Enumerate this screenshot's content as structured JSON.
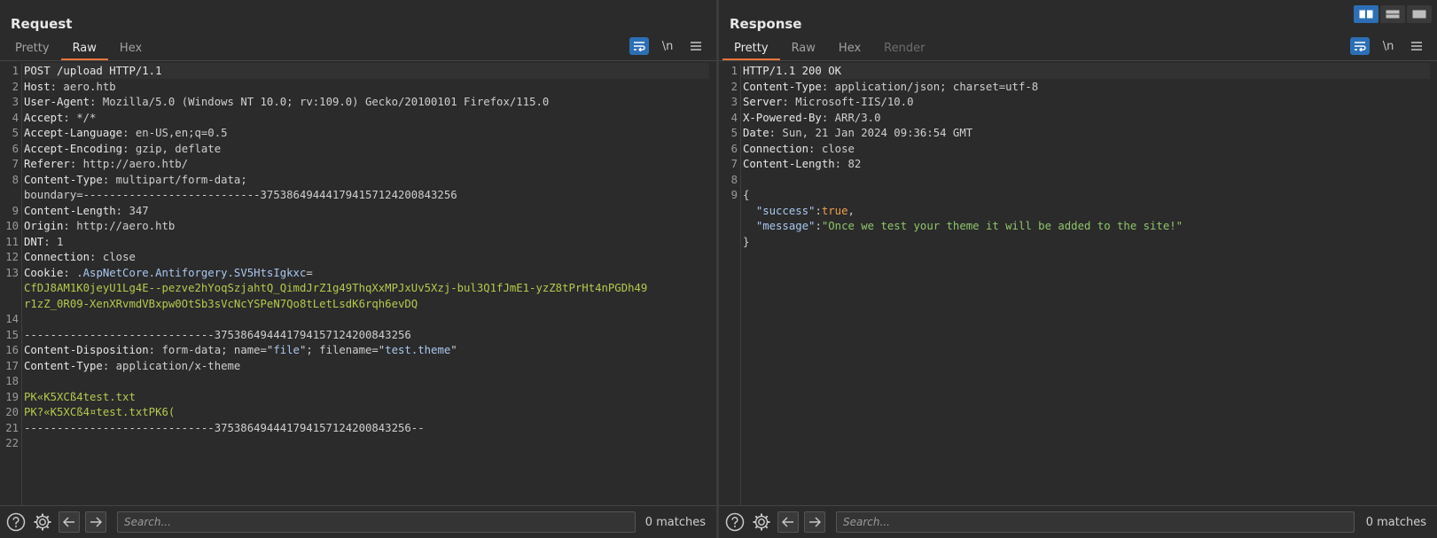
{
  "request": {
    "title": "Request",
    "tabs": [
      {
        "label": "Pretty",
        "state": "normal"
      },
      {
        "label": "Raw",
        "state": "active"
      },
      {
        "label": "Hex",
        "state": "normal"
      }
    ],
    "newline_toggle": "\\n",
    "lines": [
      {
        "n": "1",
        "parts": [
          {
            "t": "POST /upload HTTP/1.1",
            "c": "k"
          }
        ]
      },
      {
        "n": "2",
        "parts": [
          {
            "t": "Host",
            "c": "k"
          },
          {
            "t": ": aero.htb",
            "c": "v"
          }
        ]
      },
      {
        "n": "3",
        "parts": [
          {
            "t": "User-Agent",
            "c": "k"
          },
          {
            "t": ": Mozilla/5.0 (Windows NT 10.0; rv:109.0) Gecko/20100101 Firefox/115.0",
            "c": "v"
          }
        ]
      },
      {
        "n": "4",
        "parts": [
          {
            "t": "Accept",
            "c": "k"
          },
          {
            "t": ": */*",
            "c": "v"
          }
        ]
      },
      {
        "n": "5",
        "parts": [
          {
            "t": "Accept-Language",
            "c": "k"
          },
          {
            "t": ": en-US,en;q=0.5",
            "c": "v"
          }
        ]
      },
      {
        "n": "6",
        "parts": [
          {
            "t": "Accept-Encoding",
            "c": "k"
          },
          {
            "t": ": gzip, deflate",
            "c": "v"
          }
        ]
      },
      {
        "n": "7",
        "parts": [
          {
            "t": "Referer",
            "c": "k"
          },
          {
            "t": ": http://aero.htb/",
            "c": "v"
          }
        ]
      },
      {
        "n": "8",
        "parts": [
          {
            "t": "Content-Type",
            "c": "k"
          },
          {
            "t": ": multipart/form-data;",
            "c": "v"
          }
        ]
      },
      {
        "n": "",
        "parts": [
          {
            "t": "boundary=---------------------------375386494441794157124200843256",
            "c": "v"
          }
        ]
      },
      {
        "n": "9",
        "parts": [
          {
            "t": "Content-Length",
            "c": "k"
          },
          {
            "t": ": 347",
            "c": "v"
          }
        ]
      },
      {
        "n": "10",
        "parts": [
          {
            "t": "Origin",
            "c": "k"
          },
          {
            "t": ": http://aero.htb",
            "c": "v"
          }
        ]
      },
      {
        "n": "11",
        "parts": [
          {
            "t": "DNT",
            "c": "k"
          },
          {
            "t": ": 1",
            "c": "v"
          }
        ]
      },
      {
        "n": "12",
        "parts": [
          {
            "t": "Connection",
            "c": "k"
          },
          {
            "t": ": close",
            "c": "v"
          }
        ]
      },
      {
        "n": "13",
        "parts": [
          {
            "t": "Cookie",
            "c": "k"
          },
          {
            "t": ": ",
            "c": "v"
          },
          {
            "t": ".AspNetCore.Antiforgery.SV5HtsIgkxc",
            "c": "blue-t"
          },
          {
            "t": "=",
            "c": "v"
          }
        ]
      },
      {
        "n": "",
        "parts": [
          {
            "t": "CfDJ8AM1K0jeyU1Lg4E--pezve2hYoqSzjahtQ_QimdJrZ1g49ThqXxMPJxUv5Xzj-bul3Q1fJmE1-yzZ8tPrHt4nPGDh49",
            "c": "g"
          }
        ]
      },
      {
        "n": "",
        "parts": [
          {
            "t": "r1zZ_0R09-XenXRvmdVBxpw0OtSb3sVcNcYSPeN7Qo8tLetLsdK6rqh6evDQ",
            "c": "g"
          }
        ]
      },
      {
        "n": "14",
        "parts": []
      },
      {
        "n": "15",
        "parts": [
          {
            "t": "-----------------------------375386494441794157124200843256",
            "c": "v"
          }
        ]
      },
      {
        "n": "16",
        "parts": [
          {
            "t": "Content-Disposition",
            "c": "k"
          },
          {
            "t": ": form-data; name=\"",
            "c": "v"
          },
          {
            "t": "file",
            "c": "blue-t"
          },
          {
            "t": "\"; filename=\"",
            "c": "v"
          },
          {
            "t": "test.theme",
            "c": "blue-t"
          },
          {
            "t": "\"",
            "c": "v"
          }
        ]
      },
      {
        "n": "17",
        "parts": [
          {
            "t": "Content-Type",
            "c": "k"
          },
          {
            "t": ": application/x-theme",
            "c": "v"
          }
        ]
      },
      {
        "n": "18",
        "parts": []
      },
      {
        "n": "19",
        "parts": [
          {
            "t": "PK«K5XCß4test.txt",
            "c": "g"
          }
        ]
      },
      {
        "n": "20",
        "parts": [
          {
            "t": "PK?«K5XCß4¤test.txtPK6(",
            "c": "g"
          }
        ]
      },
      {
        "n": "21",
        "parts": [
          {
            "t": "-----------------------------375386494441794157124200843256--",
            "c": "v"
          }
        ]
      },
      {
        "n": "22",
        "parts": []
      }
    ],
    "search_placeholder": "Search...",
    "matches": "0 matches"
  },
  "response": {
    "title": "Response",
    "tabs": [
      {
        "label": "Pretty",
        "state": "active"
      },
      {
        "label": "Raw",
        "state": "normal"
      },
      {
        "label": "Hex",
        "state": "normal"
      },
      {
        "label": "Render",
        "state": "disabled"
      }
    ],
    "newline_toggle": "\\n",
    "lines": [
      {
        "n": "1",
        "parts": [
          {
            "t": "HTTP/1.1 200 OK",
            "c": "k"
          }
        ]
      },
      {
        "n": "2",
        "parts": [
          {
            "t": "Content-Type",
            "c": "k"
          },
          {
            "t": ": application/json; charset=utf-8",
            "c": "v"
          }
        ]
      },
      {
        "n": "3",
        "parts": [
          {
            "t": "Server",
            "c": "k"
          },
          {
            "t": ": Microsoft-IIS/10.0",
            "c": "v"
          }
        ]
      },
      {
        "n": "4",
        "parts": [
          {
            "t": "X-Powered-By",
            "c": "k"
          },
          {
            "t": ": ARR/3.0",
            "c": "v"
          }
        ]
      },
      {
        "n": "5",
        "parts": [
          {
            "t": "Date",
            "c": "k"
          },
          {
            "t": ": Sun, 21 Jan 2024 09:36:54 GMT",
            "c": "v"
          }
        ]
      },
      {
        "n": "6",
        "parts": [
          {
            "t": "Connection",
            "c": "k"
          },
          {
            "t": ": close",
            "c": "v"
          }
        ]
      },
      {
        "n": "7",
        "parts": [
          {
            "t": "Content-Length",
            "c": "k"
          },
          {
            "t": ": 82",
            "c": "v"
          }
        ]
      },
      {
        "n": "8",
        "parts": []
      },
      {
        "n": "9",
        "parts": [
          {
            "t": "{",
            "c": "v"
          }
        ]
      },
      {
        "n": "",
        "parts": [
          {
            "t": "  ",
            "c": "v"
          },
          {
            "t": "\"success\"",
            "c": "blue-t"
          },
          {
            "t": ":",
            "c": "v"
          },
          {
            "t": "true",
            "c": "o"
          },
          {
            "t": ",",
            "c": "v"
          }
        ]
      },
      {
        "n": "",
        "parts": [
          {
            "t": "  ",
            "c": "v"
          },
          {
            "t": "\"message\"",
            "c": "blue-t"
          },
          {
            "t": ":",
            "c": "v"
          },
          {
            "t": "\"Once we test your theme it will be added to the site!\"",
            "c": "str"
          }
        ]
      },
      {
        "n": "",
        "parts": [
          {
            "t": "}",
            "c": "v"
          }
        ]
      }
    ],
    "search_placeholder": "Search...",
    "matches": "0 matches"
  },
  "colors": {
    "accent_tab": "#e8743b",
    "active_tool": "#2c6fb5"
  },
  "icons": [
    "wrap-lines-icon",
    "menu-icon",
    "help-icon",
    "gear-icon",
    "arrow-left-icon",
    "arrow-right-icon",
    "split-horizontal-icon",
    "split-vertical-icon",
    "single-pane-icon"
  ]
}
